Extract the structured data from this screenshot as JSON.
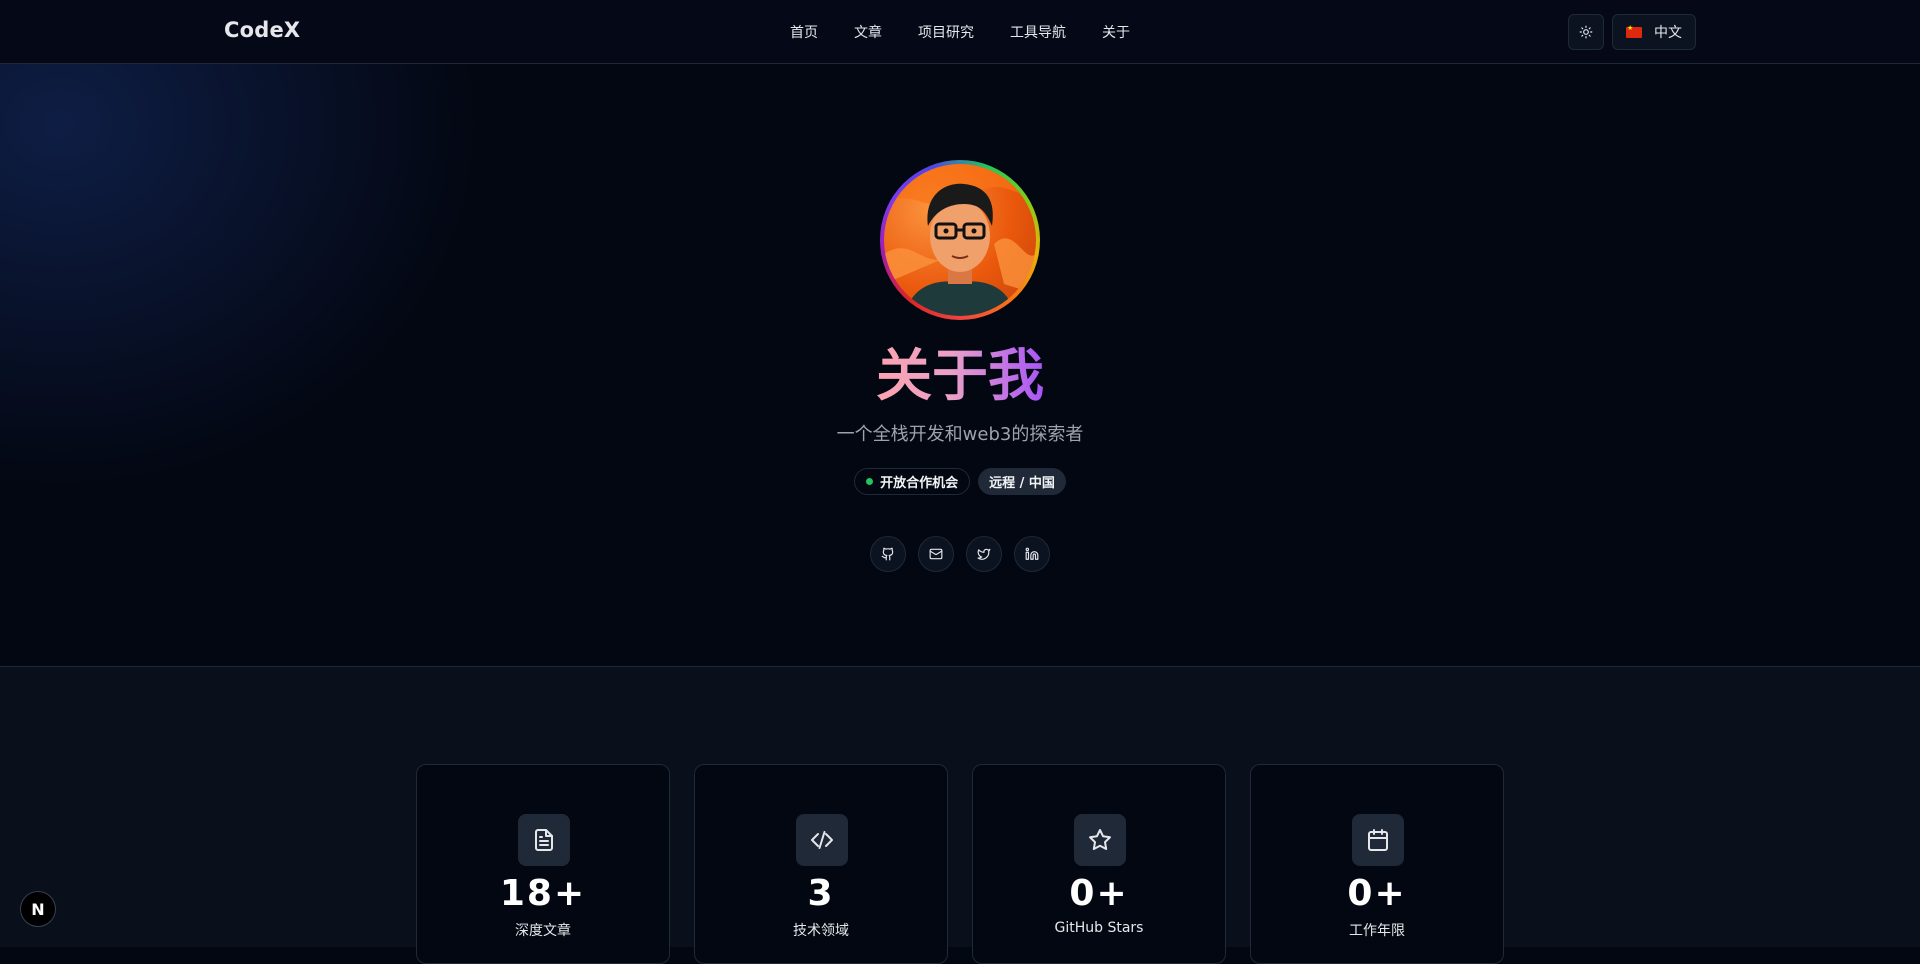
{
  "header": {
    "logo": "CodeX",
    "nav": [
      "首页",
      "文章",
      "项目研究",
      "工具导航",
      "关于"
    ],
    "language": "中文"
  },
  "hero": {
    "title": "关于我",
    "subtitle": "一个全栈开发和web3的探索者",
    "badges": {
      "availability": "开放合作机会",
      "location": "远程 / 中国"
    },
    "socials": [
      "github-icon",
      "mail-icon",
      "twitter-icon",
      "linkedin-icon"
    ]
  },
  "stats": [
    {
      "icon": "document-icon",
      "value": "18+",
      "label": "深度文章"
    },
    {
      "icon": "code-icon",
      "value": "3",
      "label": "技术领域"
    },
    {
      "icon": "star-icon",
      "value": "0+",
      "label": "GitHub Stars"
    },
    {
      "icon": "calendar-icon",
      "value": "0+",
      "label": "工作年限"
    }
  ],
  "dev_badge": "N",
  "colors": {
    "background": "#030712",
    "border": "#1f2937",
    "accent_start": "#fda4af",
    "accent_end": "#a855f7",
    "status_green": "#22c55e"
  }
}
